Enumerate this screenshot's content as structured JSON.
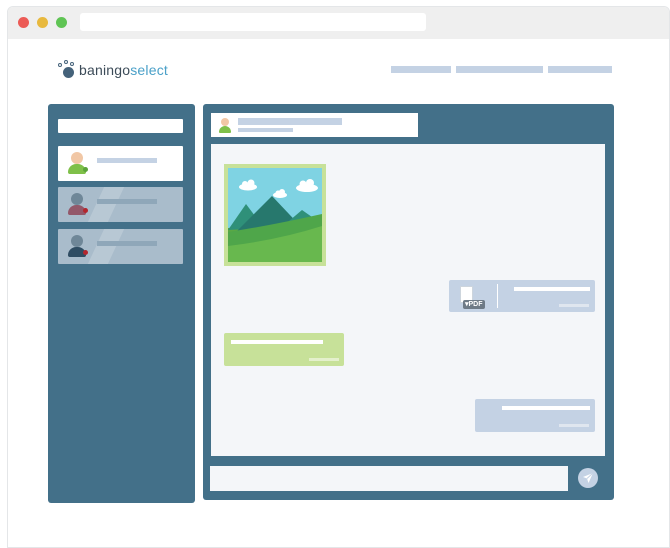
{
  "app": {
    "logo": {
      "part1": "baningo",
      "part2": "select"
    }
  },
  "colors": {
    "brand_dark": "#437089",
    "logo_accent": "#4aa0c8",
    "bubble_incoming": "#c7e199",
    "bubble_outgoing": "#c4d2e4",
    "status_online": "#5aa33a",
    "status_away": "#b3262e"
  },
  "icons": {
    "window_controls": [
      "close-dot",
      "minimize-dot",
      "maximize-dot"
    ],
    "file": "pdf-file-icon",
    "send": "paper-plane-icon"
  },
  "messages": {
    "file": {
      "badge": "▾PDF"
    }
  }
}
